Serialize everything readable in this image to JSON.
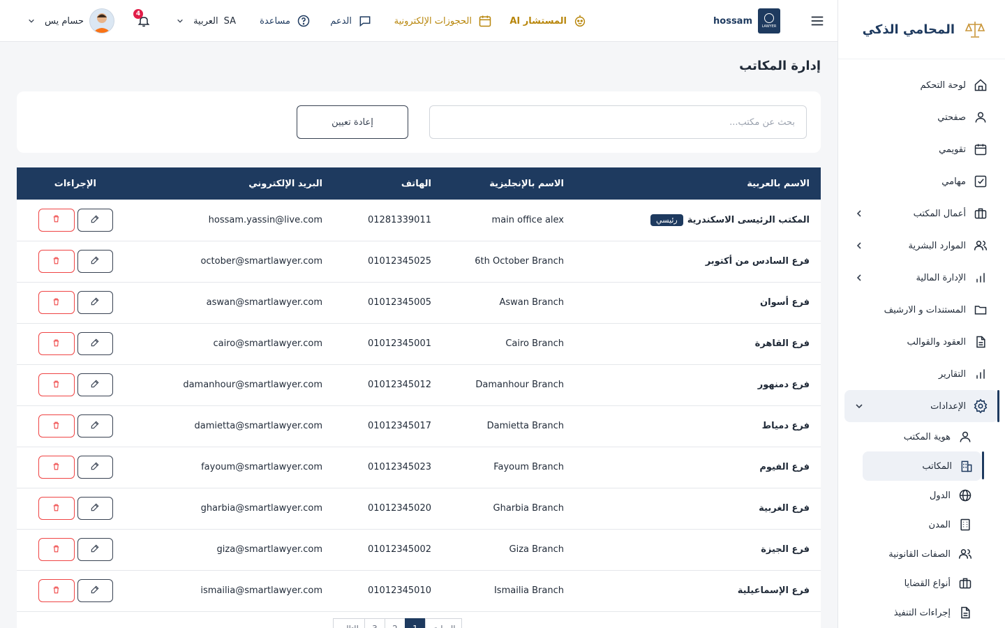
{
  "brand": {
    "name": "المحامي الذكي"
  },
  "sidebar": {
    "items": [
      {
        "label": "لوحة التحكم",
        "icon": "home-icon"
      },
      {
        "label": "صفحتي",
        "icon": "user-icon"
      },
      {
        "label": "تقويمي",
        "icon": "calendar-icon"
      },
      {
        "label": "مهامي",
        "icon": "check-square-icon"
      },
      {
        "label": "أعمال المكتب",
        "icon": "briefcase-icon",
        "expandable": true
      },
      {
        "label": "الموارد البشرية",
        "icon": "users-icon",
        "expandable": true
      },
      {
        "label": "الإدارة المالية",
        "icon": "bar-chart-icon",
        "expandable": true
      },
      {
        "label": "المستندات و الارشيف",
        "icon": "folder-icon"
      },
      {
        "label": "العقود والقوالب",
        "icon": "file-text-icon"
      },
      {
        "label": "التقارير",
        "icon": "bar-chart-icon"
      },
      {
        "label": "الإعدادات",
        "icon": "gear-icon",
        "expanded": true
      }
    ],
    "settings_sub": [
      {
        "label": "هوية المكتب",
        "icon": "user-icon"
      },
      {
        "label": "المكاتب",
        "icon": "building-icon",
        "active": true
      },
      {
        "label": "الدول",
        "icon": "globe-icon"
      },
      {
        "label": "المدن",
        "icon": "building-icon"
      },
      {
        "label": "الصفات القانونية",
        "icon": "users-icon"
      },
      {
        "label": "أنواع القضايا",
        "icon": "briefcase-icon"
      },
      {
        "label": "إجراءات التنفيذ",
        "icon": "file-text-icon"
      }
    ]
  },
  "topbar": {
    "username": "hossam",
    "ai_label": "المستشار AI",
    "bookings_label": "الحجوزات الإلكترونية",
    "support_label": "الدعم",
    "help_label": "مساعدة",
    "lang_label": "العربية",
    "lang_code": "SA",
    "notif_count": "4",
    "profile_name": "حسام يس",
    "logo_text": "LAWYER"
  },
  "page": {
    "title": "إدارة المكاتب",
    "search_placeholder": "بحث عن مكتب...",
    "reset_label": "إعادة تعيين"
  },
  "table": {
    "headers": {
      "name_ar": "الاسم بالعربية",
      "name_en": "الاسم بالإنجليزية",
      "phone": "الهاتف",
      "email": "البريد الإلكتروني",
      "actions": "الإجراءات"
    },
    "main_badge": "رئيسي",
    "rows": [
      {
        "name_ar": "المكتب الرئيسى الاسكندرية",
        "name_en": "main office alex",
        "phone": "01281339011",
        "email": "hossam.yassin@live.com",
        "main": true
      },
      {
        "name_ar": "فرع السادس من أكتوبر",
        "name_en": "6th October Branch",
        "phone": "01012345025",
        "email": "october@smartlawyer.com"
      },
      {
        "name_ar": "فرع أسوان",
        "name_en": "Aswan Branch",
        "phone": "01012345005",
        "email": "aswan@smartlawyer.com"
      },
      {
        "name_ar": "فرع القاهرة",
        "name_en": "Cairo Branch",
        "phone": "01012345001",
        "email": "cairo@smartlawyer.com"
      },
      {
        "name_ar": "فرع دمنهور",
        "name_en": "Damanhour Branch",
        "phone": "01012345012",
        "email": "damanhour@smartlawyer.com"
      },
      {
        "name_ar": "فرع دمياط",
        "name_en": "Damietta Branch",
        "phone": "01012345017",
        "email": "damietta@smartlawyer.com"
      },
      {
        "name_ar": "فرع الفيوم",
        "name_en": "Fayoum Branch",
        "phone": "01012345023",
        "email": "fayoum@smartlawyer.com"
      },
      {
        "name_ar": "فرع الغربية",
        "name_en": "Gharbia Branch",
        "phone": "01012345020",
        "email": "gharbia@smartlawyer.com"
      },
      {
        "name_ar": "فرع الجيزة",
        "name_en": "Giza Branch",
        "phone": "01012345002",
        "email": "giza@smartlawyer.com"
      },
      {
        "name_ar": "فرع الإسماعيلية",
        "name_en": "Ismailia Branch",
        "phone": "01012345010",
        "email": "ismailia@smartlawyer.com"
      }
    ]
  },
  "pager": {
    "prev": "السابق",
    "pages": [
      "1",
      "2",
      "3"
    ],
    "next": "التالي"
  },
  "colors": {
    "primary": "#1e3a5f",
    "danger": "#ef4444",
    "gold": "#b8860b"
  }
}
